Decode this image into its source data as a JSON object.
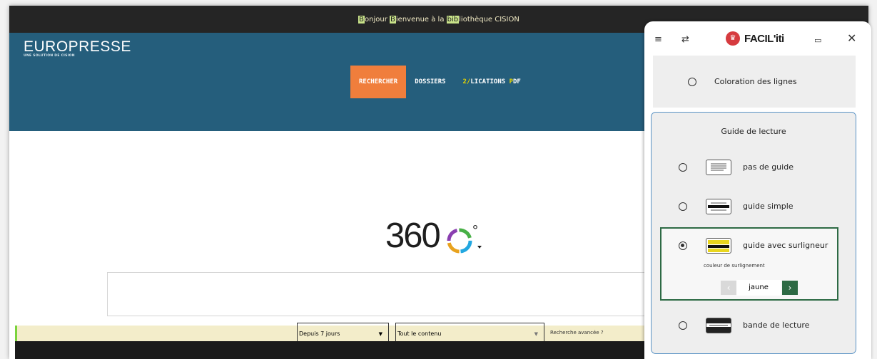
{
  "topbar": {
    "bonjour_hl": "B",
    "bonjour_rest": "onjour ",
    "bienvenue_hl": "B",
    "bienvenue_rest": "ienvenue à la ",
    "biblio_hl": "bib",
    "biblio_rest": "liothèque CISION"
  },
  "brand": {
    "name": "EUROPRESSE",
    "tagline": "UNE SOLUTION DE CISION"
  },
  "nav": {
    "items": [
      "RECHERCHER",
      "DOSSIERS",
      "LICATIONS ",
      "DF"
    ],
    "pub_marks": [
      "2/",
      "P"
    ]
  },
  "search": {
    "logo_number": "360",
    "logo_degree": "°"
  },
  "filters": {
    "period": "Depuis 7 jours",
    "content": "Tout le contenu",
    "advanced": "Recherche avancée",
    "advanced_icon": "help-circle-icon"
  },
  "panel": {
    "brand": "FACIL'iti",
    "icons": [
      "menu-icon",
      "swap-icon",
      "crown-icon",
      "screen-icon",
      "close-icon"
    ],
    "section1": {
      "label": "Coloration des lignes"
    },
    "section2": {
      "title": "Guide de lecture",
      "options": [
        "pas de guide",
        "guide simple",
        "guide avec surligneur",
        "bande de lecture"
      ],
      "selected": "guide avec surligneur",
      "color_label": "couleur de surlignement",
      "color_value": "jaune"
    }
  },
  "colors": {
    "hero": "#255e7c",
    "accent": "#f07e3c",
    "panel_selected_border": "#2d6a44",
    "panel_section_border": "#5a93c5",
    "highlight_yellow": "#e9d61e"
  }
}
